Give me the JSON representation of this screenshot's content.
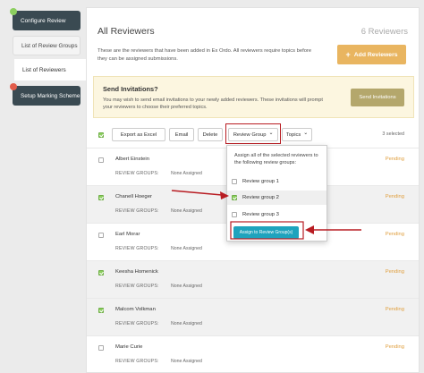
{
  "sidebar": {
    "items": [
      {
        "label": "Configure Review"
      },
      {
        "label": "List of Review Groups"
      },
      {
        "label": "List of Reviewers"
      },
      {
        "label": "Setup Marking Scheme"
      }
    ],
    "colors": {
      "done_dot": "#8ccf5f",
      "warn_dot": "#e25c4a"
    }
  },
  "header": {
    "title": "All Reviewers",
    "count": "6 Reviewers",
    "intro": "These are the reviewers that have been added in Ex Ordo. All reviewers require topics before they can be assigned submissions.",
    "add_button": "Add Reviewers",
    "add_icon": "+"
  },
  "invite": {
    "title": "Send Invitations?",
    "text": "You may wish to send email invitations to your newly added reviewers. These invitations will prompt your reviewers to choose their preferred topics.",
    "button": "Send Invitations"
  },
  "toolbar": {
    "export": "Export as Excel",
    "email": "Email",
    "delete": "Delete",
    "review_group": "Review Group",
    "topics": "Topics",
    "chevron": "⌄",
    "selected": "3 selected"
  },
  "dropdown": {
    "text": "Assign all of the selected reviewers to the following review groups:",
    "options": [
      {
        "label": "Review group 1",
        "checked": false
      },
      {
        "label": "Review group 2",
        "checked": true
      },
      {
        "label": "Review group 3",
        "checked": false
      }
    ],
    "assign_button": "Assign to Review Group(s)"
  },
  "reviewers": [
    {
      "name": "Albert Einstein",
      "groups_label": "REVIEW GROUPS:",
      "groups": "None Assigned",
      "status": "Pending",
      "checked": false
    },
    {
      "name": "Chanell Hoeger",
      "groups_label": "REVIEW GROUPS:",
      "groups": "None Assigned",
      "status": "Pending",
      "checked": true
    },
    {
      "name": "Earl Morar",
      "groups_label": "REVIEW GROUPS:",
      "groups": "None Assigned",
      "status": "Pending",
      "checked": false
    },
    {
      "name": "Keesha Homenick",
      "groups_label": "REVIEW GROUPS:",
      "groups": "None Assigned",
      "status": "Pending",
      "checked": true
    },
    {
      "name": "Malcom Volkman",
      "groups_label": "REVIEW GROUPS:",
      "groups": "None Assigned",
      "status": "Pending",
      "checked": true
    },
    {
      "name": "Marie Curie",
      "groups_label": "REVIEW GROUPS:",
      "groups": "None Assigned",
      "status": "Pending",
      "checked": false
    }
  ],
  "annotation_color": "#b81c22"
}
